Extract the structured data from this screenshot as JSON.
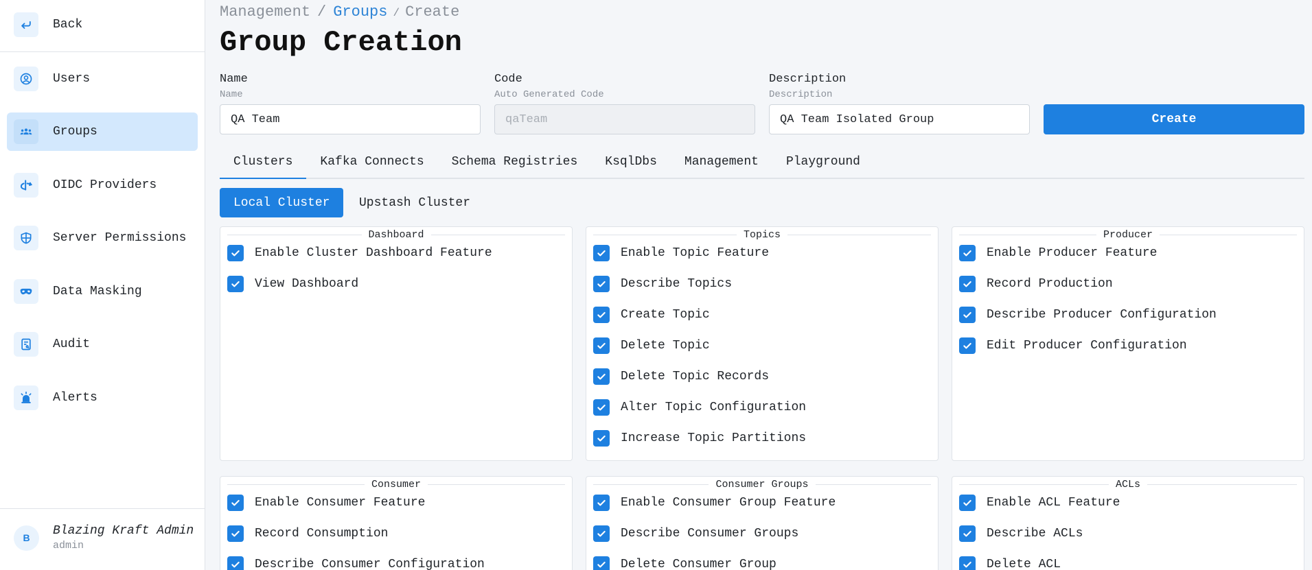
{
  "sidebar": {
    "back": {
      "label": "Back",
      "icon": "arrow-back-icon"
    },
    "items": [
      {
        "label": "Users",
        "icon": "user-circle-icon",
        "active": false
      },
      {
        "label": "Groups",
        "icon": "users-group-icon",
        "active": true
      },
      {
        "label": "OIDC Providers",
        "icon": "openid-icon",
        "active": false
      },
      {
        "label": "Server Permissions",
        "icon": "shield-icon",
        "active": false
      },
      {
        "label": "Data Masking",
        "icon": "mask-icon",
        "active": false
      },
      {
        "label": "Audit",
        "icon": "report-icon",
        "active": false
      },
      {
        "label": "Alerts",
        "icon": "siren-icon",
        "active": false
      }
    ],
    "user": {
      "initial": "B",
      "name": "Blazing Kraft Admin",
      "role": "admin"
    }
  },
  "breadcrumb": {
    "root": "Management",
    "sep": "/",
    "groups": "Groups",
    "current": "Create"
  },
  "page_title": "Group Creation",
  "form": {
    "name": {
      "label": "Name",
      "sub": "Name",
      "value": "QA Team"
    },
    "code": {
      "label": "Code",
      "sub": "Auto Generated Code",
      "placeholder": "qaTeam"
    },
    "description": {
      "label": "Description",
      "sub": "Description",
      "value": "QA Team Isolated Group"
    },
    "create_label": "Create"
  },
  "tabs": [
    "Clusters",
    "Kafka Connects",
    "Schema Registries",
    "KsqlDbs",
    "Management",
    "Playground"
  ],
  "clusters": [
    "Local Cluster",
    "Upstash Cluster"
  ],
  "panels": {
    "dashboard": {
      "title": "Dashboard",
      "items": [
        "Enable Cluster Dashboard Feature",
        "View Dashboard"
      ]
    },
    "topics": {
      "title": "Topics",
      "items": [
        "Enable Topic Feature",
        "Describe Topics",
        "Create Topic",
        "Delete Topic",
        "Delete Topic Records",
        "Alter Topic Configuration",
        "Increase Topic Partitions"
      ]
    },
    "producer": {
      "title": "Producer",
      "items": [
        "Enable Producer Feature",
        "Record Production",
        "Describe Producer Configuration",
        "Edit Producer Configuration"
      ]
    },
    "consumer": {
      "title": "Consumer",
      "items": [
        "Enable Consumer Feature",
        "Record Consumption",
        "Describe Consumer Configuration"
      ]
    },
    "consumer_groups": {
      "title": "Consumer Groups",
      "items": [
        "Enable Consumer Group Feature",
        "Describe Consumer Groups",
        "Delete Consumer Group"
      ]
    },
    "acls": {
      "title": "ACLs",
      "items": [
        "Enable ACL Feature",
        "Describe ACLs",
        "Delete ACL"
      ]
    }
  },
  "colors": {
    "accent": "#1e80e0",
    "active_nav": "#d3e8fd"
  }
}
